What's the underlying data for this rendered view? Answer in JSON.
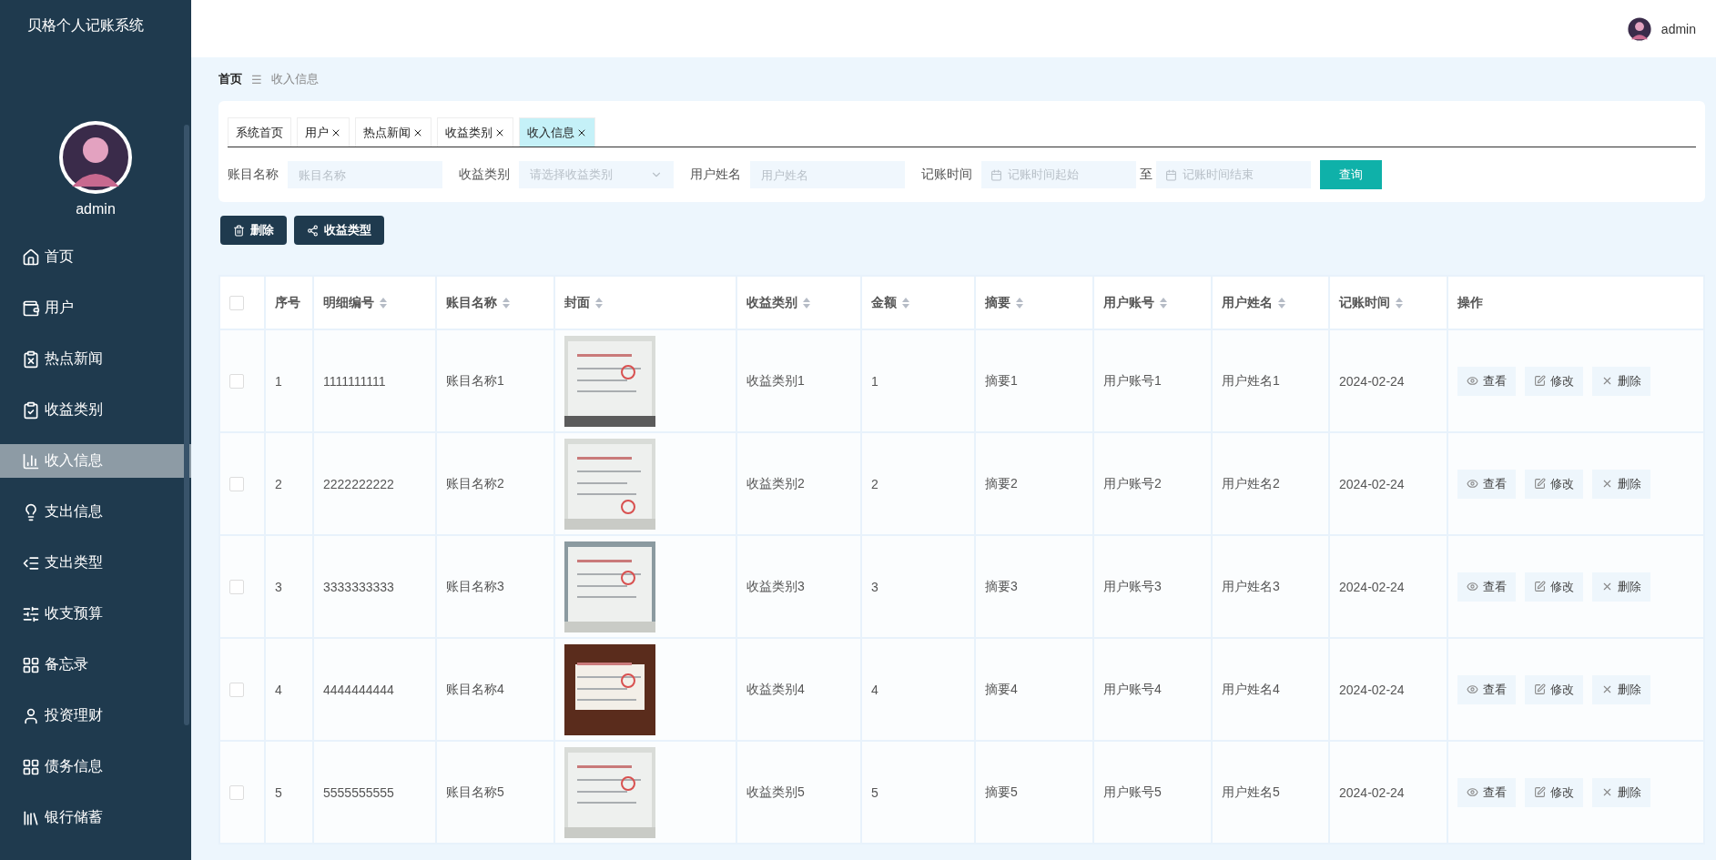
{
  "app": {
    "title": "贝格个人记账系统"
  },
  "sidebar": {
    "user": "admin",
    "items": [
      {
        "label": "首页",
        "selected": false
      },
      {
        "label": "用户",
        "selected": false
      },
      {
        "label": "热点新闻",
        "selected": false
      },
      {
        "label": "收益类别",
        "selected": false
      },
      {
        "label": "收入信息",
        "selected": true
      },
      {
        "label": "支出信息",
        "selected": false
      },
      {
        "label": "支出类型",
        "selected": false
      },
      {
        "label": "收支预算",
        "selected": false
      },
      {
        "label": "备忘录",
        "selected": false
      },
      {
        "label": "投资理财",
        "selected": false
      },
      {
        "label": "债务信息",
        "selected": false
      },
      {
        "label": "银行储蓄",
        "selected": false
      }
    ]
  },
  "header": {
    "user": "admin"
  },
  "breadcrumb": {
    "home": "首页",
    "separator": "☰",
    "current": "收入信息"
  },
  "tabs": [
    {
      "label": "系统首页",
      "closable": false,
      "selected": false
    },
    {
      "label": "用户",
      "closable": true,
      "selected": false
    },
    {
      "label": "热点新闻",
      "closable": true,
      "selected": false
    },
    {
      "label": "收益类别",
      "closable": true,
      "selected": false
    },
    {
      "label": "收入信息",
      "closable": true,
      "selected": true
    }
  ],
  "filters": [
    {
      "kind": "text",
      "label": "账目名称",
      "placeholder": "账目名称"
    },
    {
      "kind": "select",
      "label": "收益类别",
      "placeholder": "请选择收益类别"
    },
    {
      "kind": "text",
      "label": "用户姓名",
      "placeholder": "用户姓名"
    },
    {
      "kind": "daterange",
      "label": "记账时间",
      "placeholder": "记账时间起始",
      "joiner": "至",
      "placeholder_end": "记账时间结束"
    }
  ],
  "search_button": "查询",
  "actions": [
    {
      "kind": "delete",
      "label": "删除"
    },
    {
      "kind": "share",
      "label": "收益类型"
    }
  ],
  "table": {
    "select_all": {
      "checked": false
    },
    "columns": [
      {
        "label": "序号",
        "sortable": false
      },
      {
        "label": "明细编号",
        "sortable": true
      },
      {
        "label": "账目名称",
        "sortable": true
      },
      {
        "label": "封面",
        "sortable": true
      },
      {
        "label": "收益类别",
        "sortable": true
      },
      {
        "label": "金额",
        "sortable": true
      },
      {
        "label": "摘要",
        "sortable": true
      },
      {
        "label": "用户账号",
        "sortable": true
      },
      {
        "label": "用户姓名",
        "sortable": true
      },
      {
        "label": "记账时间",
        "sortable": true
      },
      {
        "label": "操作",
        "sortable": false
      }
    ],
    "rows": [
      {
        "checked": false,
        "cells": [
          "1",
          "1111111111",
          "账目名称1",
          {
            "kind": "picture"
          },
          "收益类别1",
          "1",
          "摘要1",
          "用户账号1",
          "用户姓名1",
          "2024-02-24"
        ],
        "actions": [
          {
            "kind": "view",
            "label": "查看"
          },
          {
            "kind": "edit",
            "label": "修改"
          },
          {
            "kind": "delete",
            "label": "删除"
          }
        ]
      },
      {
        "checked": false,
        "cells": [
          "2",
          "2222222222",
          "账目名称2",
          {
            "kind": "picture"
          },
          "收益类别2",
          "2",
          "摘要2",
          "用户账号2",
          "用户姓名2",
          "2024-02-24"
        ],
        "actions": [
          {
            "kind": "view",
            "label": "查看"
          },
          {
            "kind": "edit",
            "label": "修改"
          },
          {
            "kind": "delete",
            "label": "删除"
          }
        ]
      },
      {
        "checked": false,
        "cells": [
          "3",
          "3333333333",
          "账目名称3",
          {
            "kind": "picture"
          },
          "收益类别3",
          "3",
          "摘要3",
          "用户账号3",
          "用户姓名3",
          "2024-02-24"
        ],
        "actions": [
          {
            "kind": "view",
            "label": "查看"
          },
          {
            "kind": "edit",
            "label": "修改"
          },
          {
            "kind": "delete",
            "label": "删除"
          }
        ]
      },
      {
        "checked": false,
        "cells": [
          "4",
          "4444444444",
          "账目名称4",
          {
            "kind": "picture"
          },
          "收益类别4",
          "4",
          "摘要4",
          "用户账号4",
          "用户姓名4",
          "2024-02-24"
        ],
        "actions": [
          {
            "kind": "view",
            "label": "查看"
          },
          {
            "kind": "edit",
            "label": "修改"
          },
          {
            "kind": "delete",
            "label": "删除"
          }
        ]
      },
      {
        "checked": false,
        "cells": [
          "5",
          "5555555555",
          "账目名称5",
          {
            "kind": "picture"
          },
          "收益类别5",
          "5",
          "摘要5",
          "用户账号5",
          "用户姓名5",
          "2024-02-24"
        ],
        "actions": [
          {
            "kind": "view",
            "label": "查看"
          },
          {
            "kind": "edit",
            "label": "修改"
          },
          {
            "kind": "delete",
            "label": "删除"
          }
        ]
      }
    ]
  }
}
